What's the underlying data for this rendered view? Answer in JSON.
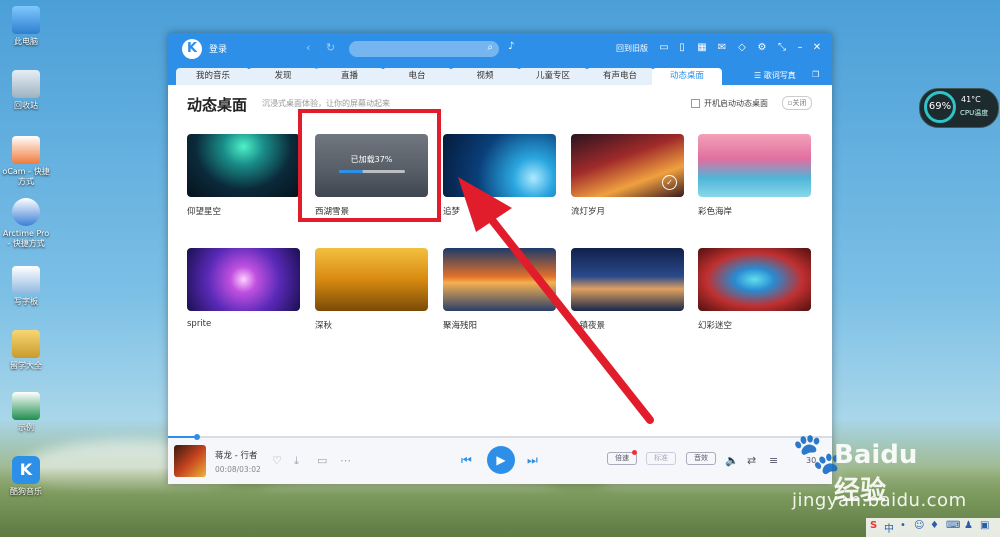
{
  "desktop": {
    "icons": [
      {
        "label": "此电脑"
      },
      {
        "label": "回收站"
      },
      {
        "label": "oCam - 快捷方式"
      },
      {
        "label": "Arctime Pro - 快捷方式"
      },
      {
        "label": "写字板"
      },
      {
        "label": "留学大全"
      },
      {
        "label": "示例"
      },
      {
        "label": "酷狗音乐"
      }
    ],
    "cpu_widget": {
      "percent": "69%",
      "temp": "41°C",
      "label": "CPU温度"
    }
  },
  "window": {
    "logo": "K",
    "login": "登录",
    "search_icon": "search-icon",
    "old_version": "回到旧版",
    "tabs": [
      {
        "label": "我的音乐"
      },
      {
        "label": "发现"
      },
      {
        "label": "直播"
      },
      {
        "label": "电台"
      },
      {
        "label": "视频"
      },
      {
        "label": "儿童专区"
      },
      {
        "label": "有声电台"
      },
      {
        "label": "动态桌面"
      }
    ],
    "active_tab": "动态桌面",
    "lyrics_btn": "歌词写真",
    "page": {
      "title": "动态桌面",
      "subtitle": "沉浸式桌面体验，让你的屏幕动起来",
      "autostart": "开机启动动态桌面",
      "close_label": "关闭"
    },
    "wallpapers": [
      {
        "name": "仰望星空"
      },
      {
        "name": "西湖雪景",
        "loading": "已加载37%",
        "progress": 0.37
      },
      {
        "name": "追梦"
      },
      {
        "name": "流灯岁月",
        "selected": true
      },
      {
        "name": "彩色海岸"
      },
      {
        "name": "sprite"
      },
      {
        "name": "深秋"
      },
      {
        "name": "聚海残阳"
      },
      {
        "name": "小镇夜景"
      },
      {
        "name": "幻彩迷空"
      }
    ],
    "player": {
      "song": "蒋龙 - 行者",
      "time": "00:08/03:02",
      "progress": 0.044,
      "speed": "倍速",
      "quality": "标准",
      "effect": "音效",
      "count": "30"
    }
  },
  "watermark": {
    "brand": "Baidu经验",
    "url": "jingyan.baidu.com"
  },
  "tray": {
    "ime": "中"
  },
  "colors": {
    "accent": "#2d8fe8",
    "annotation": "#e11d2b"
  }
}
